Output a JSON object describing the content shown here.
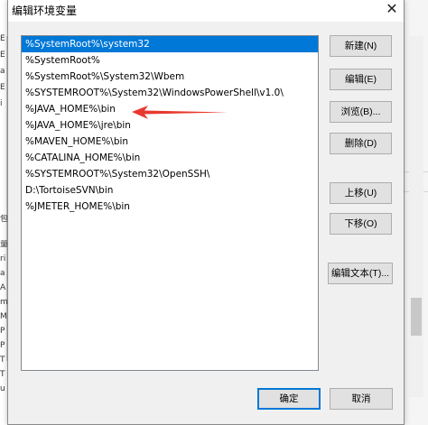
{
  "window": {
    "title": "编辑环境变量",
    "close_glyph": "✕"
  },
  "path_list": {
    "items": [
      "%SystemRoot%\\system32",
      "%SystemRoot%",
      "%SystemRoot%\\System32\\Wbem",
      "%SYSTEMROOT%\\System32\\WindowsPowerShell\\v1.0\\",
      "%JAVA_HOME%\\bin",
      "%JAVA_HOME%\\jre\\bin",
      "%MAVEN_HOME%\\bin",
      "%CATALINA_HOME%\\bin",
      "%SYSTEMROOT%\\System32\\OpenSSH\\",
      "D:\\TortoiseSVN\\bin",
      "%JMETER_HOME%\\bin"
    ],
    "selected_index": 0
  },
  "buttons": {
    "new": "新建(N)",
    "edit": "编辑(E)",
    "browse": "浏览(B)...",
    "delete": "删除(D)",
    "move_up": "上移(U)",
    "move_down": "下移(O)",
    "edit_text": "编辑文本(T)...",
    "ok": "确定",
    "cancel": "取消"
  },
  "background_fragments": [
    "E",
    "E",
    "a",
    "E",
    "i",
    "包",
    "量",
    "ri",
    "a",
    "A",
    "m",
    "M",
    "P",
    "P",
    "T",
    "T",
    "u"
  ],
  "colors": {
    "selection": "#0078d7",
    "annotation_arrow": "#e8392f",
    "dialog_bg": "#f0f0f0",
    "button_bg": "#e1e1e1"
  }
}
